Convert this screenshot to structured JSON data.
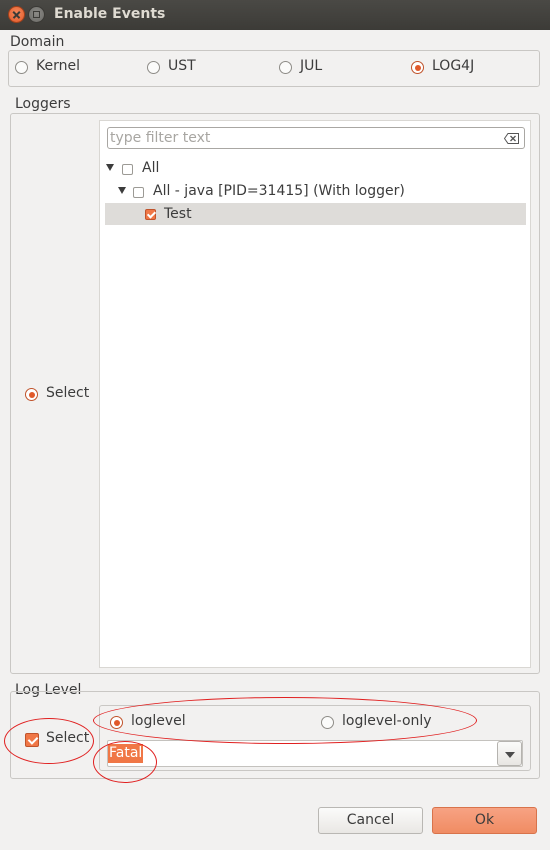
{
  "window": {
    "title": "Enable Events"
  },
  "domain": {
    "label": "Domain",
    "options": [
      {
        "label": "Kernel",
        "selected": false
      },
      {
        "label": "UST",
        "selected": false
      },
      {
        "label": "JUL",
        "selected": false
      },
      {
        "label": "LOG4J",
        "selected": true
      }
    ]
  },
  "loggers": {
    "label": "Loggers",
    "select_label": "Select",
    "filter_placeholder": "type filter text",
    "tree": {
      "root_label": "All",
      "child_label": "All - java [PID=31415] (With logger)",
      "leaf_label": "Test",
      "leaf_checked": true
    }
  },
  "log_level": {
    "label": "Log Level",
    "select_label": "Select",
    "select_checked": true,
    "options": [
      {
        "label": "loglevel",
        "selected": true
      },
      {
        "label": "loglevel-only",
        "selected": false
      }
    ],
    "combo_value": "Fatal"
  },
  "buttons": {
    "cancel": "Cancel",
    "ok": "Ok"
  },
  "colors": {
    "accent": "#f07746",
    "annotation": "#e02020",
    "titlebar": "#3c3b37"
  },
  "icons": {
    "close": "close-icon",
    "maximize": "maximize-icon",
    "clear": "clear-filter-icon",
    "expand": "expand-arrow-icon",
    "dropdown": "dropdown-arrow-icon"
  }
}
